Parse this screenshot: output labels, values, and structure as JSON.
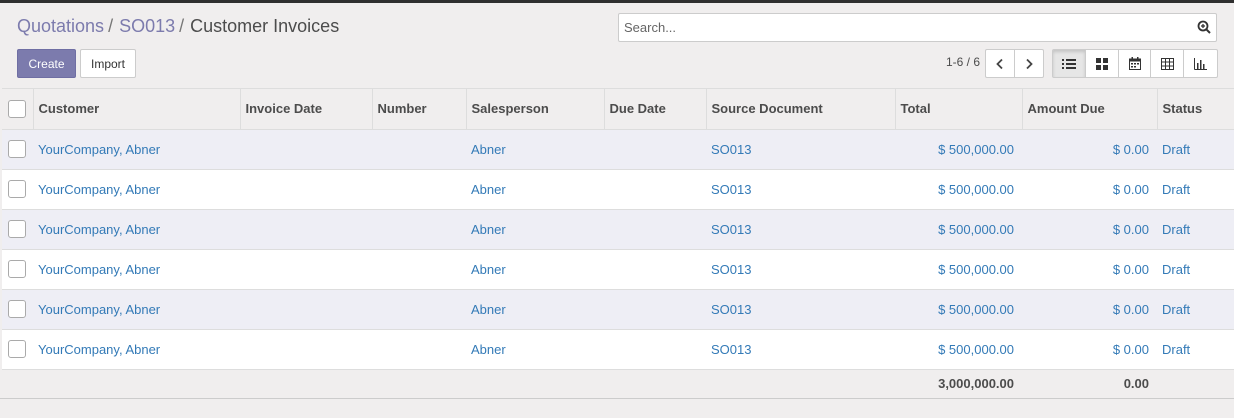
{
  "breadcrumb": [
    {
      "label": "Quotations",
      "link": true
    },
    {
      "label": "SO013",
      "link": true
    },
    {
      "label": "Customer Invoices",
      "link": false
    }
  ],
  "breadcrumb_separator": "/",
  "search": {
    "placeholder": "Search..."
  },
  "buttons": {
    "create": "Create",
    "import": "Import"
  },
  "pager": {
    "value": "1-6 / 6"
  },
  "colors": {
    "primary": "#7c7bad",
    "link": "#337ab7",
    "row_alt": "#eeeef5"
  },
  "table": {
    "columns": [
      "Customer",
      "Invoice Date",
      "Number",
      "Salesperson",
      "Due Date",
      "Source Document",
      "Total",
      "Amount Due",
      "Status"
    ],
    "rows": [
      {
        "customer": "YourCompany, Abner",
        "invoice_date": "",
        "number": "",
        "salesperson": "Abner",
        "due_date": "",
        "source": "SO013",
        "total": "$ 500,000.00",
        "amount_due": "$ 0.00",
        "status": "Draft"
      },
      {
        "customer": "YourCompany, Abner",
        "invoice_date": "",
        "number": "",
        "salesperson": "Abner",
        "due_date": "",
        "source": "SO013",
        "total": "$ 500,000.00",
        "amount_due": "$ 0.00",
        "status": "Draft"
      },
      {
        "customer": "YourCompany, Abner",
        "invoice_date": "",
        "number": "",
        "salesperson": "Abner",
        "due_date": "",
        "source": "SO013",
        "total": "$ 500,000.00",
        "amount_due": "$ 0.00",
        "status": "Draft"
      },
      {
        "customer": "YourCompany, Abner",
        "invoice_date": "",
        "number": "",
        "salesperson": "Abner",
        "due_date": "",
        "source": "SO013",
        "total": "$ 500,000.00",
        "amount_due": "$ 0.00",
        "status": "Draft"
      },
      {
        "customer": "YourCompany, Abner",
        "invoice_date": "",
        "number": "",
        "salesperson": "Abner",
        "due_date": "",
        "source": "SO013",
        "total": "$ 500,000.00",
        "amount_due": "$ 0.00",
        "status": "Draft"
      },
      {
        "customer": "YourCompany, Abner",
        "invoice_date": "",
        "number": "",
        "salesperson": "Abner",
        "due_date": "",
        "source": "SO013",
        "total": "$ 500,000.00",
        "amount_due": "$ 0.00",
        "status": "Draft"
      }
    ],
    "totals": {
      "total": "3,000,000.00",
      "amount_due": "0.00"
    }
  }
}
